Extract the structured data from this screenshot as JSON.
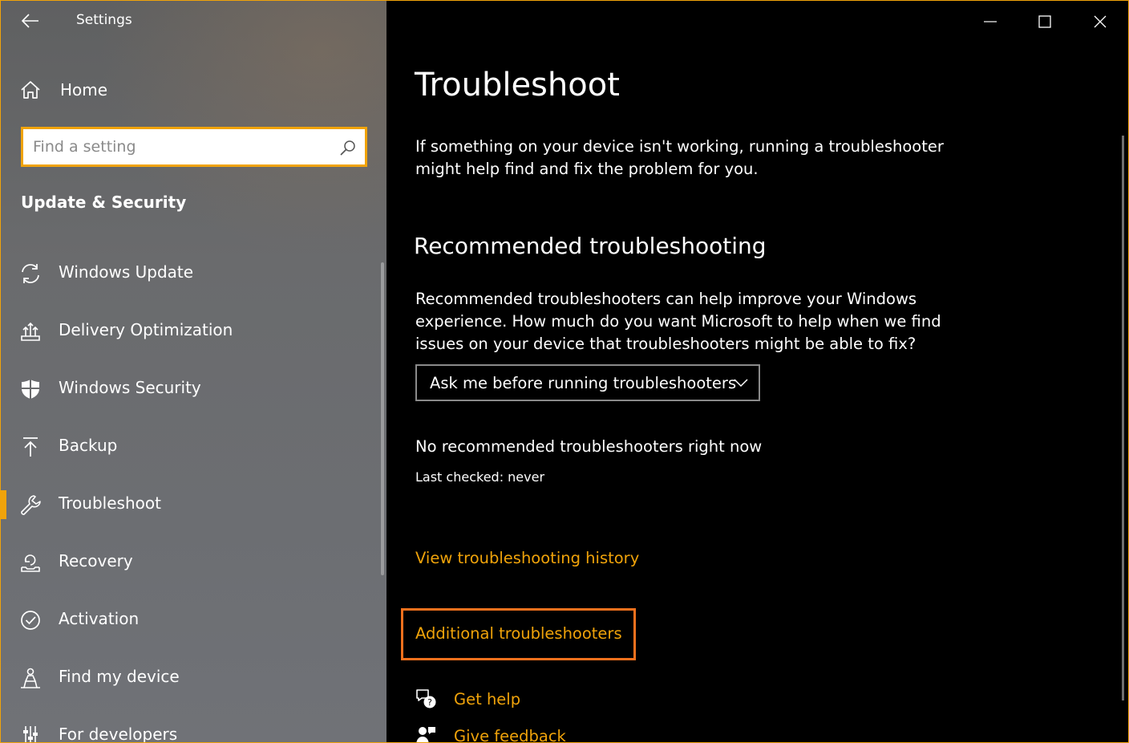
{
  "window": {
    "title": "Settings",
    "accent_color": "#f0a30a",
    "highlight_color": "#f4711d"
  },
  "sidebar": {
    "home_label": "Home",
    "search": {
      "placeholder": "Find a setting",
      "value": ""
    },
    "section_title": "Update & Security",
    "items": [
      {
        "label": "Windows Update",
        "icon": "refresh-icon"
      },
      {
        "label": "Delivery Optimization",
        "icon": "delivery-optimization-icon"
      },
      {
        "label": "Windows Security",
        "icon": "shield-icon"
      },
      {
        "label": "Backup",
        "icon": "upload-arrow-icon"
      },
      {
        "label": "Troubleshoot",
        "icon": "wrench-icon",
        "selected": true
      },
      {
        "label": "Recovery",
        "icon": "recovery-icon"
      },
      {
        "label": "Activation",
        "icon": "check-circle-icon"
      },
      {
        "label": "Find my device",
        "icon": "person-locate-icon"
      },
      {
        "label": "For developers",
        "icon": "developer-sliders-icon"
      }
    ]
  },
  "main": {
    "title": "Troubleshoot",
    "intro": "If something on your device isn't working, running a troubleshooter might help find and fix the problem for you.",
    "recommended": {
      "heading": "Recommended troubleshooting",
      "description": "Recommended troubleshooters can help improve your Windows experience. How much do you want Microsoft to help when we find issues on your device that troubleshooters might be able to fix?",
      "dropdown_value": "Ask me before running troubleshooters",
      "status": "No recommended troubleshooters right now",
      "last_checked": "Last checked: never"
    },
    "links": {
      "view_history": "View troubleshooting history",
      "additional": "Additional troubleshooters",
      "get_help": "Get help",
      "give_feedback": "Give feedback"
    }
  }
}
